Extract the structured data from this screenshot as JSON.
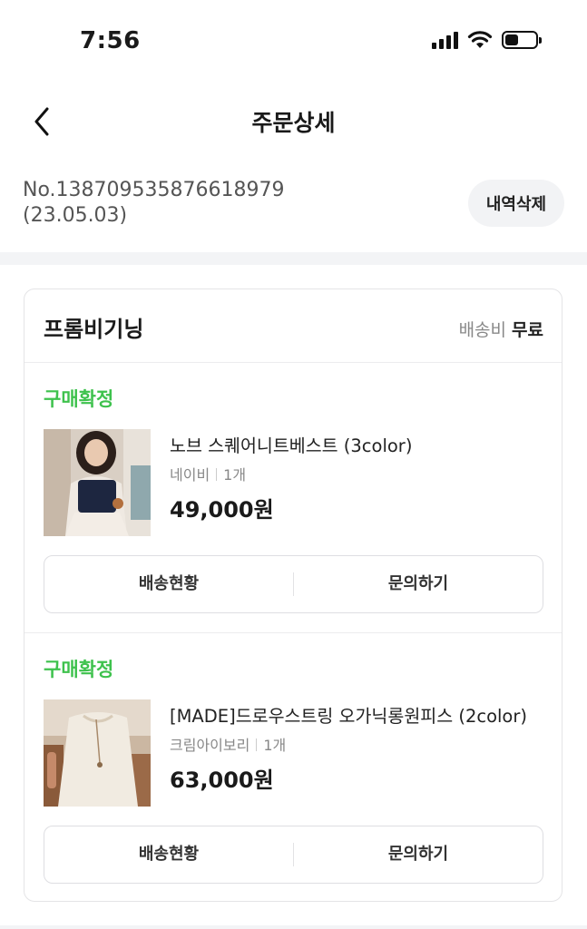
{
  "status_bar": {
    "time": "7:56",
    "battery_level": 0.45,
    "icons": [
      "signal-icon",
      "wifi-icon",
      "battery-icon"
    ]
  },
  "header": {
    "title": "주문상세",
    "back_icon": "chevron-left-icon"
  },
  "order": {
    "number": "No.138709535876618979",
    "date": "(23.05.03)",
    "delete_label": "내역삭제"
  },
  "shop": {
    "name": "프롬비기닝",
    "shipping_label": "배송비",
    "shipping_value": "무료"
  },
  "items": [
    {
      "status": "구매확정",
      "name": "노브 스퀘어니트베스트 (3color)",
      "option": "네이비",
      "quantity": "1개",
      "price": "49,000원",
      "actions": {
        "tracking": "배송현황",
        "inquiry": "문의하기"
      }
    },
    {
      "status": "구매확정",
      "name": "[MADE]드로우스트링 오가닉롱원피스 (2color)",
      "option": "크림아이보리",
      "quantity": "1개",
      "price": "63,000원",
      "actions": {
        "tracking": "배송현황",
        "inquiry": "문의하기"
      }
    }
  ],
  "colors": {
    "status_green": "#3ec24d",
    "band_gray": "#f3f4f6",
    "button_gray": "#f2f3f5"
  }
}
